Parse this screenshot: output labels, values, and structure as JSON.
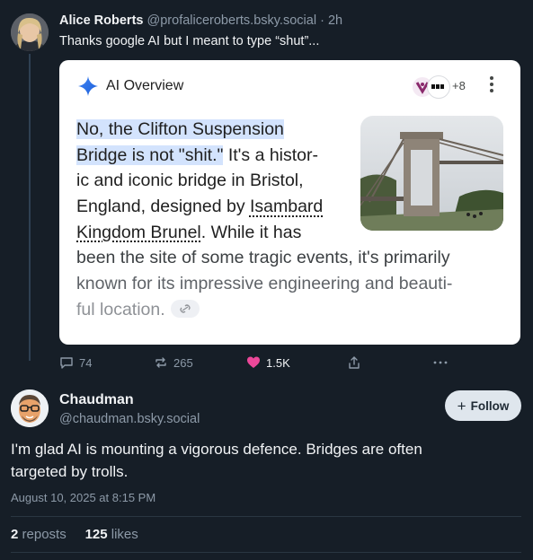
{
  "post1": {
    "author_name": "Alice Roberts",
    "author_handle": "@profaliceroberts.bsky.social",
    "separator": "·",
    "time_ago": "2h",
    "text": "Thanks google AI but I meant to type “shut”...",
    "embed": {
      "title": "AI Overview",
      "sources_more": "+8",
      "body_highlight_1": "No, the Clifton Suspension",
      "body_highlight_2": "Bridge is not \"shit.\"",
      "body_1b": " It's a histor-",
      "body_3": "ic and iconic bridge in Bristol,",
      "body_4a": "England, designed by ",
      "body_4b": "Isambard",
      "body_5a": "Kingdom Brunel",
      "body_5b": ". While it has",
      "body_6": "been the site of some tragic events, it's primarily",
      "body_7": "known for its impressive engineering and beauti-",
      "body_8": "ful location."
    },
    "actions": {
      "replies": "74",
      "reposts": "265",
      "likes": "1.5K"
    }
  },
  "post2": {
    "author_name": "Chaudman",
    "author_handle": "@chaudman.bsky.social",
    "follow_label": "Follow",
    "text_line_1": "I'm glad AI is mounting a vigorous defence. Bridges are often",
    "text_line_2": "targeted by trolls.",
    "timestamp": "August 10, 2025 at 8:15 PM",
    "reposts_count": "2",
    "reposts_label": "reposts",
    "likes_count": "125",
    "likes_label": "likes"
  },
  "colors": {
    "background": "#161e27",
    "like_heart": "#ec4899",
    "highlight": "#d3e3fd",
    "muted_text": "#8d9aa8"
  },
  "icons": [
    "avatar-photo",
    "gemini-sparkle-icon",
    "source-favicon",
    "kebab-menu-icon",
    "link-icon",
    "reply-icon",
    "repost-icon",
    "heart-icon",
    "share-icon",
    "more-icon",
    "plus-icon"
  ]
}
